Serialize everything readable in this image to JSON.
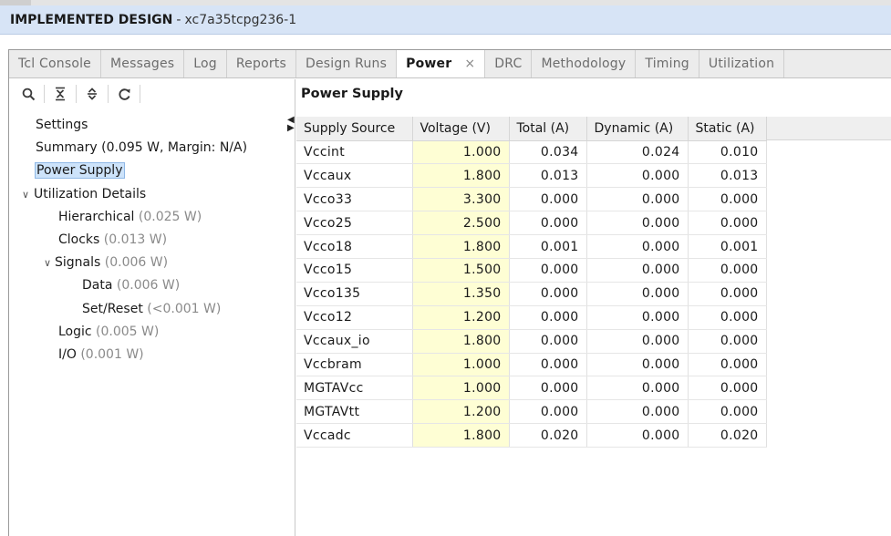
{
  "title_bar": {
    "mode": "IMPLEMENTED DESIGN",
    "separator": "-",
    "part": "xc7a35tcpg236-1"
  },
  "tabs": [
    {
      "label": "Tcl Console"
    },
    {
      "label": "Messages"
    },
    {
      "label": "Log"
    },
    {
      "label": "Reports"
    },
    {
      "label": "Design Runs"
    },
    {
      "label": "Power",
      "active": true,
      "close": "×"
    },
    {
      "label": "DRC"
    },
    {
      "label": "Methodology"
    },
    {
      "label": "Timing"
    },
    {
      "label": "Utilization"
    }
  ],
  "toolbar": {
    "icons": [
      "search-icon",
      "collapse-all-icon",
      "expand-all-icon",
      "refresh-icon"
    ]
  },
  "tree": {
    "settings": "Settings",
    "summary": "Summary (0.095 W, Margin: N/A)",
    "power_supply": "Power Supply",
    "utilization_details": "Utilization Details",
    "hierarchical": {
      "label": "Hierarchical",
      "value": "(0.025 W)"
    },
    "clocks": {
      "label": "Clocks",
      "value": "(0.013 W)"
    },
    "signals": {
      "label": "Signals",
      "value": "(0.006 W)"
    },
    "data": {
      "label": "Data",
      "value": "(0.006 W)"
    },
    "set_reset": {
      "label": "Set/Reset",
      "value": "(<0.001 W)"
    },
    "logic": {
      "label": "Logic",
      "value": "(0.005 W)"
    },
    "io": {
      "label": "I/O",
      "value": "(0.001 W)"
    }
  },
  "power_supply": {
    "title": "Power Supply",
    "columns": [
      "Supply Source",
      "Voltage (V)",
      "Total (A)",
      "Dynamic (A)",
      "Static (A)"
    ],
    "rows": [
      [
        "Vccint",
        "1.000",
        "0.034",
        "0.024",
        "0.010"
      ],
      [
        "Vccaux",
        "1.800",
        "0.013",
        "0.000",
        "0.013"
      ],
      [
        "Vcco33",
        "3.300",
        "0.000",
        "0.000",
        "0.000"
      ],
      [
        "Vcco25",
        "2.500",
        "0.000",
        "0.000",
        "0.000"
      ],
      [
        "Vcco18",
        "1.800",
        "0.001",
        "0.000",
        "0.001"
      ],
      [
        "Vcco15",
        "1.500",
        "0.000",
        "0.000",
        "0.000"
      ],
      [
        "Vcco135",
        "1.350",
        "0.000",
        "0.000",
        "0.000"
      ],
      [
        "Vcco12",
        "1.200",
        "0.000",
        "0.000",
        "0.000"
      ],
      [
        "Vccaux_io",
        "1.800",
        "0.000",
        "0.000",
        "0.000"
      ],
      [
        "Vccbram",
        "1.000",
        "0.000",
        "0.000",
        "0.000"
      ],
      [
        "MGTAVcc",
        "1.000",
        "0.000",
        "0.000",
        "0.000"
      ],
      [
        "MGTAVtt",
        "1.200",
        "0.000",
        "0.000",
        "0.000"
      ],
      [
        "Vccadc",
        "1.800",
        "0.020",
        "0.000",
        "0.020"
      ]
    ]
  },
  "colors": {
    "title_bar_bg": "#d7e4f6",
    "voltage_cell_bg": "#fefed4",
    "selection_bg": "#cde3fa"
  }
}
